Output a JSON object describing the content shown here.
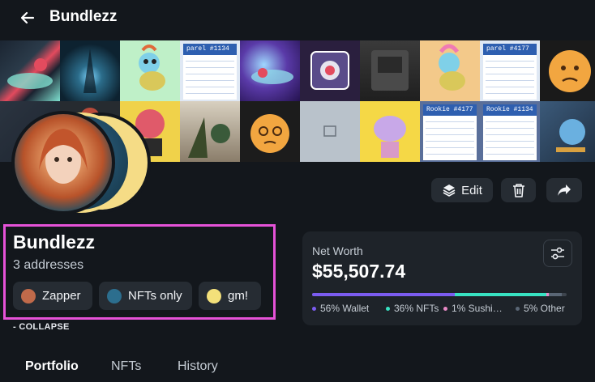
{
  "header": {
    "title": "Bundlezz",
    "back_icon": "arrow-left-icon"
  },
  "banner": {
    "card_texts": [
      "parel #1134",
      "parel #4177",
      "Rookie #4177",
      "Rookie #1134"
    ]
  },
  "actions": {
    "edit_label": "Edit",
    "edit_icon": "layers-icon",
    "delete_icon": "trash-icon",
    "share_icon": "share-arrow-icon"
  },
  "profile": {
    "name": "Bundlezz",
    "addresses": "3 addresses",
    "chips": [
      {
        "label": "Zapper",
        "color": "#c06a4a"
      },
      {
        "label": "NFTs only",
        "color": "#2c6e8e"
      },
      {
        "label": "gm!",
        "color": "#f3e07a"
      }
    ],
    "collapse_label": "- COLLAPSE"
  },
  "net_worth": {
    "label": "Net Worth",
    "value": "$55,507.74",
    "settings_icon": "sliders-icon",
    "segments": [
      {
        "label": "56% Wallet",
        "pct": 56,
        "color": "#7b5cf0"
      },
      {
        "label": "36% NFTs",
        "pct": 36,
        "color": "#38e2c2"
      },
      {
        "label": "1% Sushi…",
        "pct": 1,
        "color": "#e88ac6"
      },
      {
        "label": "5% Other",
        "pct": 5,
        "color": "#5a6675"
      }
    ]
  },
  "tabs": [
    {
      "label": "Portfolio",
      "active": true
    },
    {
      "label": "NFTs",
      "active": false
    },
    {
      "label": "History",
      "active": false
    }
  ]
}
